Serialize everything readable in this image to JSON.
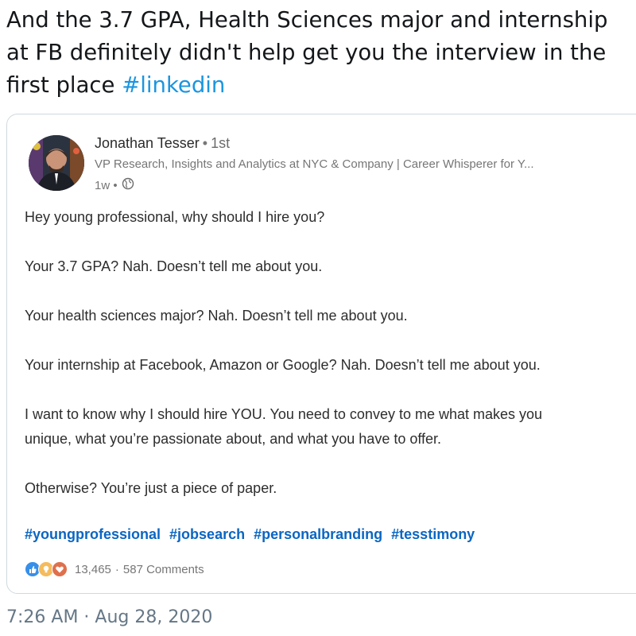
{
  "tweet": {
    "text": "And the 3.7 GPA, Health Sciences major and internship at FB definitely didn't help get you the interview in the first place ",
    "hashtag": "#linkedin",
    "timestamp": "7:26 AM · Aug 28, 2020"
  },
  "post": {
    "author_name": "Jonathan Tesser",
    "separator": "•",
    "degree": "1st",
    "headline": "VP Research, Insights and Analytics at NYC & Company | Career Whisperer for Y...",
    "time": "1w •",
    "body": [
      "Hey young professional, why should I hire you?",
      "Your 3.7 GPA? Nah. Doesn’t tell me about you.",
      "Your health sciences major? Nah. Doesn’t tell me about you.",
      "Your internship at Facebook, Amazon or Google? Nah. Doesn’t tell me about you.",
      "I want to know why I should hire YOU. You need to convey to me what makes you",
      "unique, what you’re passionate about, and what you have to offer.",
      "Otherwise? You’re just a piece of paper."
    ],
    "hashtags": [
      "#youngprofessional",
      "#jobsearch",
      "#personalbranding",
      "#tesstimony"
    ],
    "reaction_icons": [
      "like-icon",
      "insightful-icon",
      "love-icon"
    ],
    "reaction_count": "13,465",
    "comment_sep": "·",
    "comments": "587 Comments"
  },
  "colors": {
    "hashtag_twitter": "#1b95e0",
    "hashtag_linkedin": "#0a66c2",
    "like": "#378fe9",
    "insightful": "#f5bb5c",
    "love": "#df704d"
  }
}
